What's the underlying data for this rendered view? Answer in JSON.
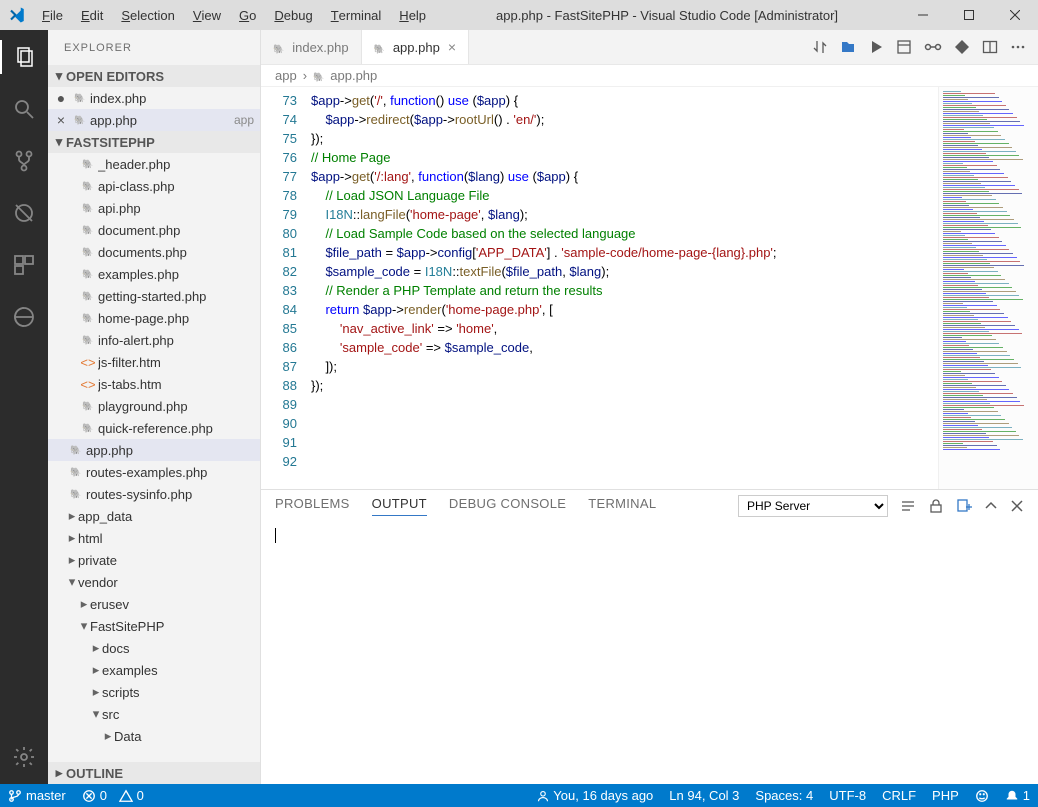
{
  "window": {
    "title": "app.php - FastSitePHP - Visual Studio Code [Administrator]"
  },
  "menu": [
    "File",
    "Edit",
    "Selection",
    "View",
    "Go",
    "Debug",
    "Terminal",
    "Help"
  ],
  "sidebar": {
    "header": "EXPLORER",
    "openEditors": {
      "title": "OPEN EDITORS"
    },
    "project": {
      "title": "FASTSITEPHP"
    },
    "outline": {
      "title": "OUTLINE"
    }
  },
  "openEditors": [
    {
      "name": "index.php",
      "icon": "php",
      "meta": "",
      "close": false
    },
    {
      "name": "app.php",
      "icon": "php",
      "meta": "app",
      "close": true,
      "selected": true
    }
  ],
  "files": [
    {
      "d": 1,
      "t": "f",
      "icon": "php",
      "name": "_header.php"
    },
    {
      "d": 1,
      "t": "f",
      "icon": "php",
      "name": "api-class.php"
    },
    {
      "d": 1,
      "t": "f",
      "icon": "php",
      "name": "api.php"
    },
    {
      "d": 1,
      "t": "f",
      "icon": "php",
      "name": "document.php"
    },
    {
      "d": 1,
      "t": "f",
      "icon": "php",
      "name": "documents.php"
    },
    {
      "d": 1,
      "t": "f",
      "icon": "php",
      "name": "examples.php"
    },
    {
      "d": 1,
      "t": "f",
      "icon": "php",
      "name": "getting-started.php"
    },
    {
      "d": 1,
      "t": "f",
      "icon": "php",
      "name": "home-page.php"
    },
    {
      "d": 1,
      "t": "f",
      "icon": "php",
      "name": "info-alert.php"
    },
    {
      "d": 1,
      "t": "f",
      "icon": "htm",
      "name": "js-filter.htm"
    },
    {
      "d": 1,
      "t": "f",
      "icon": "htm",
      "name": "js-tabs.htm"
    },
    {
      "d": 1,
      "t": "f",
      "icon": "php",
      "name": "playground.php"
    },
    {
      "d": 1,
      "t": "f",
      "icon": "php",
      "name": "quick-reference.php"
    },
    {
      "d": 0,
      "t": "f",
      "icon": "php",
      "name": "app.php",
      "selected": true
    },
    {
      "d": 0,
      "t": "f",
      "icon": "php",
      "name": "routes-examples.php"
    },
    {
      "d": 0,
      "t": "f",
      "icon": "php",
      "name": "routes-sysinfo.php"
    },
    {
      "d": 0,
      "t": "d",
      "open": false,
      "name": "app_data"
    },
    {
      "d": 0,
      "t": "d",
      "open": false,
      "name": "html"
    },
    {
      "d": 0,
      "t": "d",
      "open": false,
      "name": "private"
    },
    {
      "d": 0,
      "t": "d",
      "open": true,
      "name": "vendor"
    },
    {
      "d": 1,
      "t": "d",
      "open": false,
      "name": "erusev"
    },
    {
      "d": 1,
      "t": "d",
      "open": true,
      "name": "FastSitePHP"
    },
    {
      "d": 2,
      "t": "d",
      "open": false,
      "name": "docs"
    },
    {
      "d": 2,
      "t": "d",
      "open": false,
      "name": "examples"
    },
    {
      "d": 2,
      "t": "d",
      "open": false,
      "name": "scripts"
    },
    {
      "d": 2,
      "t": "d",
      "open": true,
      "name": "src"
    },
    {
      "d": 3,
      "t": "d",
      "open": false,
      "name": "Data"
    }
  ],
  "tabs": [
    {
      "name": "index.php",
      "active": false
    },
    {
      "name": "app.php",
      "active": true
    }
  ],
  "breadcrumb": {
    "a": "app",
    "b": "app.php"
  },
  "code": {
    "start": 73,
    "lines": [
      [
        [
          "var",
          "$app"
        ],
        [
          "op",
          "->"
        ],
        [
          "fn",
          "get"
        ],
        [
          "pu",
          "("
        ],
        [
          "str",
          "'/'"
        ],
        [
          "pu",
          ", "
        ],
        [
          "kw",
          "function"
        ],
        [
          "pu",
          "() "
        ],
        [
          "kw",
          "use"
        ],
        [
          "pu",
          " ("
        ],
        [
          "var",
          "$app"
        ],
        [
          "pu",
          ") {"
        ]
      ],
      [
        [
          "pu",
          "    "
        ],
        [
          "var",
          "$app"
        ],
        [
          "op",
          "->"
        ],
        [
          "fn",
          "redirect"
        ],
        [
          "pu",
          "("
        ],
        [
          "var",
          "$app"
        ],
        [
          "op",
          "->"
        ],
        [
          "fn",
          "rootUrl"
        ],
        [
          "pu",
          "() . "
        ],
        [
          "str",
          "'en/'"
        ],
        [
          "pu",
          ");"
        ]
      ],
      [
        [
          "pu",
          "});"
        ]
      ],
      [
        [
          "pu",
          ""
        ]
      ],
      [
        [
          "cm",
          "// Home Page"
        ]
      ],
      [
        [
          "var",
          "$app"
        ],
        [
          "op",
          "->"
        ],
        [
          "fn",
          "get"
        ],
        [
          "pu",
          "("
        ],
        [
          "str",
          "'/:lang'"
        ],
        [
          "pu",
          ", "
        ],
        [
          "kw",
          "function"
        ],
        [
          "pu",
          "("
        ],
        [
          "var",
          "$lang"
        ],
        [
          "pu",
          ") "
        ],
        [
          "kw",
          "use"
        ],
        [
          "pu",
          " ("
        ],
        [
          "var",
          "$app"
        ],
        [
          "pu",
          ") {"
        ]
      ],
      [
        [
          "pu",
          "    "
        ],
        [
          "cm",
          "// Load JSON Language File"
        ]
      ],
      [
        [
          "pu",
          "    "
        ],
        [
          "cls",
          "I18N"
        ],
        [
          "op",
          "::"
        ],
        [
          "fn",
          "langFile"
        ],
        [
          "pu",
          "("
        ],
        [
          "str",
          "'home-page'"
        ],
        [
          "pu",
          ", "
        ],
        [
          "var",
          "$lang"
        ],
        [
          "pu",
          ");"
        ]
      ],
      [
        [
          "pu",
          ""
        ]
      ],
      [
        [
          "pu",
          "    "
        ],
        [
          "cm",
          "// Load Sample Code based on the selected language"
        ]
      ],
      [
        [
          "pu",
          "    "
        ],
        [
          "var",
          "$file_path"
        ],
        [
          "pu",
          " = "
        ],
        [
          "var",
          "$app"
        ],
        [
          "op",
          "->"
        ],
        [
          "var",
          "config"
        ],
        [
          "pu",
          "["
        ],
        [
          "str",
          "'APP_DATA'"
        ],
        [
          "pu",
          "] . "
        ],
        [
          "str",
          "'sample-code/home-page-{lang}.php'"
        ],
        [
          "pu",
          ";"
        ]
      ],
      [
        [
          "pu",
          "    "
        ],
        [
          "var",
          "$sample_code"
        ],
        [
          "pu",
          " = "
        ],
        [
          "cls",
          "I18N"
        ],
        [
          "op",
          "::"
        ],
        [
          "fn",
          "textFile"
        ],
        [
          "pu",
          "("
        ],
        [
          "var",
          "$file_path"
        ],
        [
          "pu",
          ", "
        ],
        [
          "var",
          "$lang"
        ],
        [
          "pu",
          ");"
        ]
      ],
      [
        [
          "pu",
          ""
        ]
      ],
      [
        [
          "pu",
          "    "
        ],
        [
          "cm",
          "// Render a PHP Template and return the results"
        ]
      ],
      [
        [
          "pu",
          "    "
        ],
        [
          "kw",
          "return"
        ],
        [
          "pu",
          " "
        ],
        [
          "var",
          "$app"
        ],
        [
          "op",
          "->"
        ],
        [
          "fn",
          "render"
        ],
        [
          "pu",
          "("
        ],
        [
          "str",
          "'home-page.php'"
        ],
        [
          "pu",
          ", ["
        ]
      ],
      [
        [
          "pu",
          "        "
        ],
        [
          "str",
          "'nav_active_link'"
        ],
        [
          "pu",
          " => "
        ],
        [
          "str",
          "'home'"
        ],
        [
          "pu",
          ","
        ]
      ],
      [
        [
          "pu",
          "        "
        ],
        [
          "str",
          "'sample_code'"
        ],
        [
          "pu",
          " => "
        ],
        [
          "var",
          "$sample_code"
        ],
        [
          "pu",
          ","
        ]
      ],
      [
        [
          "pu",
          "    ]);"
        ]
      ],
      [
        [
          "pu",
          "});"
        ]
      ],
      [
        [
          "pu",
          ""
        ]
      ]
    ]
  },
  "panel": {
    "tabs": [
      "PROBLEMS",
      "OUTPUT",
      "DEBUG CONSOLE",
      "TERMINAL"
    ],
    "active": 1,
    "select": "PHP Server"
  },
  "status": {
    "branch": "master",
    "errors": "0",
    "warnings": "0",
    "blame": "You, 16 days ago",
    "lncol": "Ln 94, Col 3",
    "spaces": "Spaces: 4",
    "encoding": "UTF-8",
    "eol": "CRLF",
    "lang": "PHP",
    "bell": "1"
  }
}
